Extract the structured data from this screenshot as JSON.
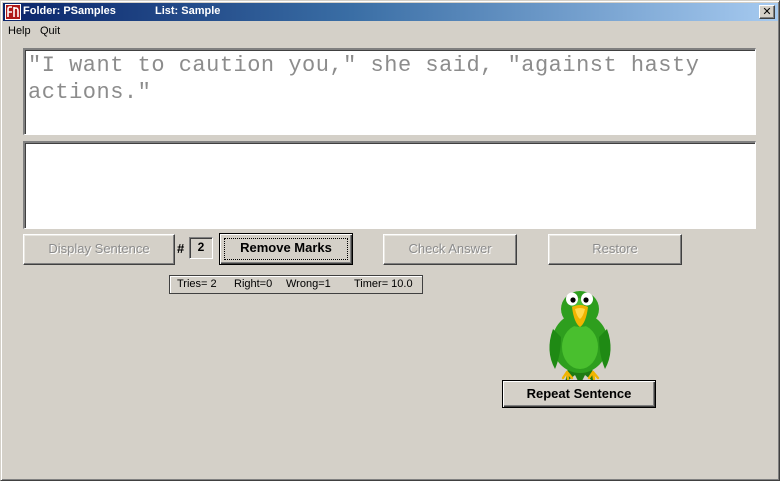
{
  "titlebar": {
    "folder": "Folder: PSamples",
    "list": "List: Sample",
    "close_glyph": "✕"
  },
  "menu": {
    "items": [
      "Help",
      "Quit"
    ]
  },
  "sentence": {
    "text": "\"I want to caution you,\" she said, \"against hasty actions.\""
  },
  "answer": {
    "text": ""
  },
  "buttons": {
    "display_sentence": "Display Sentence",
    "remove_marks": "Remove Marks",
    "check_answer": "Check Answer",
    "restore": "Restore",
    "repeat_sentence": "Repeat Sentence"
  },
  "counter": {
    "prefix": "#",
    "value": "2"
  },
  "stats": {
    "tries": "Tries= 2",
    "right": "Right=0",
    "wrong": "Wrong=1",
    "timer": "Timer= 10.0"
  },
  "icons": {
    "app": "app-logo-icon",
    "mascot": "parrot-mascot"
  },
  "colors": {
    "title_gradient_start": "#0a246a",
    "title_gradient_end": "#a6caf0",
    "face": "#d4d0c8",
    "sentence_text": "#8c8c8c",
    "parrot_body": "#2e9e1e",
    "parrot_beak": "#f0b400"
  }
}
